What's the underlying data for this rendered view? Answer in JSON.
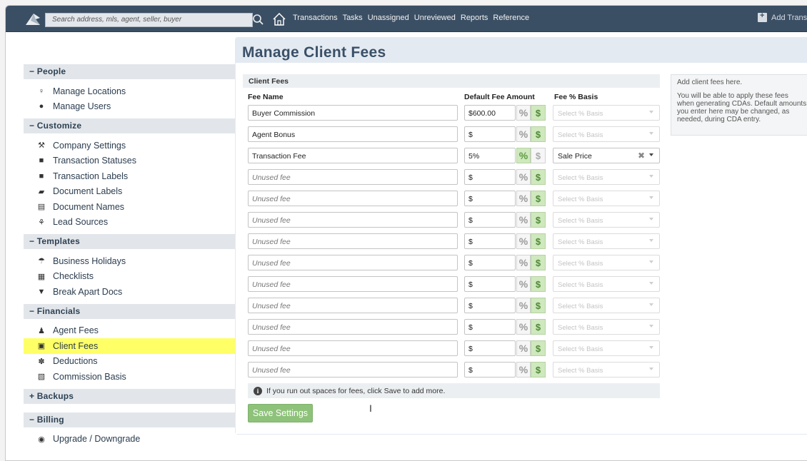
{
  "topbar": {
    "search_placeholder": "Search address, mls, agent, seller, buyer",
    "nav": [
      "Transactions",
      "Tasks",
      "Unassigned",
      "Unreviewed",
      "Reports",
      "Reference"
    ],
    "add_trans_label": "Add Trans"
  },
  "sidebar": {
    "people": {
      "label": "− People",
      "items": [
        "Manage Locations",
        "Manage Users"
      ]
    },
    "customize": {
      "label": "− Customize",
      "items": [
        "Company Settings",
        "Transaction Statuses",
        "Transaction Labels",
        "Document Labels",
        "Document Names",
        "Lead Sources"
      ]
    },
    "templates": {
      "label": "− Templates",
      "items": [
        "Business Holidays",
        "Checklists",
        "Break Apart Docs"
      ]
    },
    "financials": {
      "label": "− Financials",
      "items": [
        "Agent Fees",
        "Client Fees",
        "Deductions",
        "Commission Basis"
      ]
    },
    "backups": {
      "label": "+ Backups"
    },
    "billing": {
      "label": "− Billing",
      "items": [
        "Upgrade / Downgrade"
      ]
    }
  },
  "main": {
    "title": "Manage Client Fees",
    "section_title": "Client Fees",
    "col_fee_name": "Fee Name",
    "col_default_amount": "Default Fee Amount",
    "col_basis": "Fee % Basis",
    "rows": [
      {
        "name": "Buyer Commission",
        "amount": "$600.00",
        "mode": "dollar",
        "basis": "Select % Basis"
      },
      {
        "name": "Agent Bonus",
        "amount": "$",
        "mode": "dollar",
        "basis": "Select % Basis"
      },
      {
        "name": "Transaction Fee",
        "amount": "5%",
        "mode": "percent",
        "basis": "Sale Price"
      },
      {
        "name": "Unused fee",
        "amount": "$",
        "mode": "dollar",
        "basis": "Select % Basis"
      },
      {
        "name": "Unused fee",
        "amount": "$",
        "mode": "dollar",
        "basis": "Select % Basis"
      },
      {
        "name": "Unused fee",
        "amount": "$",
        "mode": "dollar",
        "basis": "Select % Basis"
      },
      {
        "name": "Unused fee",
        "amount": "$",
        "mode": "dollar",
        "basis": "Select % Basis"
      },
      {
        "name": "Unused fee",
        "amount": "$",
        "mode": "dollar",
        "basis": "Select % Basis"
      },
      {
        "name": "Unused fee",
        "amount": "$",
        "mode": "dollar",
        "basis": "Select % Basis"
      },
      {
        "name": "Unused fee",
        "amount": "$",
        "mode": "dollar",
        "basis": "Select % Basis"
      },
      {
        "name": "Unused fee",
        "amount": "$",
        "mode": "dollar",
        "basis": "Select % Basis"
      },
      {
        "name": "Unused fee",
        "amount": "$",
        "mode": "dollar",
        "basis": "Select % Basis"
      },
      {
        "name": "Unused fee",
        "amount": "$",
        "mode": "dollar",
        "basis": "Select % Basis"
      }
    ],
    "info_text": "If you run out spaces for fees, click Save to add more.",
    "save_label": "Save Settings"
  },
  "help": {
    "line1": "Add client fees here.",
    "line2": "You will be able to apply these fees when generating CDAs. Default amounts you enter here may be changed, as needed, during CDA entry."
  },
  "colors": {
    "topbar": "#3b4f64",
    "active_item": "#ffff66",
    "save": "#8ec27a",
    "toggle_on": "#cfe8bd"
  }
}
